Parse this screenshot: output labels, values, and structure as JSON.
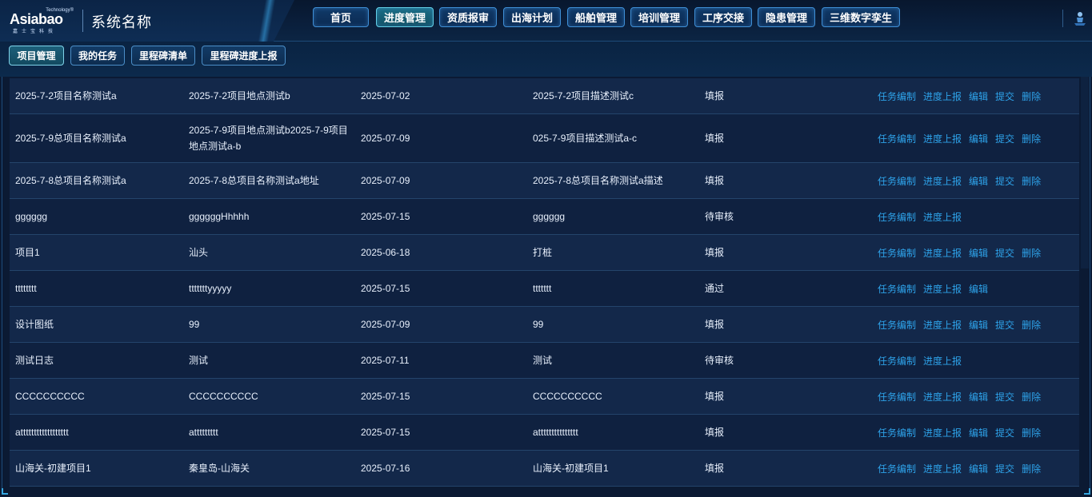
{
  "brand": {
    "logo_text": "Asiabao",
    "logo_tagline": "Technology®",
    "logo_sub": "嘉士宝科技",
    "system_name": "系统名称"
  },
  "main_nav": [
    {
      "label": "首页",
      "active": false
    },
    {
      "label": "进度管理",
      "active": true
    },
    {
      "label": "资质报审",
      "active": false
    },
    {
      "label": "出海计划",
      "active": false
    },
    {
      "label": "船舶管理",
      "active": false
    },
    {
      "label": "培训管理",
      "active": false
    },
    {
      "label": "工序交接",
      "active": false
    },
    {
      "label": "隐患管理",
      "active": false
    },
    {
      "label": "三维数字孪生",
      "active": false
    }
  ],
  "sub_nav": [
    {
      "label": "项目管理",
      "active": true
    },
    {
      "label": "我的任务",
      "active": false
    },
    {
      "label": "里程碑清单",
      "active": false
    },
    {
      "label": "里程碑进度上报",
      "active": false
    }
  ],
  "table": {
    "rows": [
      {
        "name": "2025-7-2项目名称测试a",
        "location": "2025-7-2项目地点测试b",
        "date": "2025-07-02",
        "description": "2025-7-2项目描述测试c",
        "status": "填报",
        "actions": [
          "任务编制",
          "进度上报",
          "编辑",
          "提交",
          "删除"
        ]
      },
      {
        "name": "2025-7-9总项目名称测试a",
        "location": "2025-7-9项目地点测试b2025-7-9项目地点测试a-b",
        "date": "2025-07-09",
        "description": "025-7-9项目描述测试a-c",
        "status": "填报",
        "actions": [
          "任务编制",
          "进度上报",
          "编辑",
          "提交",
          "删除"
        ]
      },
      {
        "name": "2025-7-8总项目名称测试a",
        "location": "2025-7-8总项目名称测试a地址",
        "date": "2025-07-09",
        "description": "2025-7-8总项目名称测试a描述",
        "status": "填报",
        "actions": [
          "任务编制",
          "进度上报",
          "编辑",
          "提交",
          "删除"
        ]
      },
      {
        "name": "gggggg",
        "location": "ggggggHhhhh",
        "date": "2025-07-15",
        "description": "gggggg",
        "status": "待审核",
        "actions": [
          "任务编制",
          "进度上报"
        ]
      },
      {
        "name": "项目1",
        "location": "汕头",
        "date": "2025-06-18",
        "description": "打桩",
        "status": "填报",
        "actions": [
          "任务编制",
          "进度上报",
          "编辑",
          "提交",
          "删除"
        ]
      },
      {
        "name": "tttttttt",
        "location": "tttttttyyyyy",
        "date": "2025-07-15",
        "description": "ttttttt",
        "status": "通过",
        "actions": [
          "任务编制",
          "进度上报",
          "编辑"
        ]
      },
      {
        "name": "设计图纸",
        "location": "99",
        "date": "2025-07-09",
        "description": "99",
        "status": "填报",
        "actions": [
          "任务编制",
          "进度上报",
          "编辑",
          "提交",
          "删除"
        ]
      },
      {
        "name": "测试日志",
        "location": "测试",
        "date": "2025-07-11",
        "description": "测试",
        "status": "待审核",
        "actions": [
          "任务编制",
          "进度上报"
        ]
      },
      {
        "name": "CCCCCCCCCC",
        "location": "CCCCCCCCCC",
        "date": "2025-07-15",
        "description": "CCCCCCCCCC",
        "status": "填报",
        "actions": [
          "任务编制",
          "进度上报",
          "编辑",
          "提交",
          "删除"
        ]
      },
      {
        "name": "atttttttttttttttttt",
        "location": "attttttttt",
        "date": "2025-07-15",
        "description": "attttttttttttttt",
        "status": "填报",
        "actions": [
          "任务编制",
          "进度上报",
          "编辑",
          "提交",
          "删除"
        ]
      },
      {
        "name": "山海关-初建项目1",
        "location": "秦皇岛-山海关",
        "date": "2025-07-16",
        "description": "山海关-初建项目1",
        "status": "填报",
        "actions": [
          "任务编制",
          "进度上报",
          "编辑",
          "提交",
          "删除"
        ]
      }
    ]
  },
  "icons": {
    "corner": "user-figure-icon"
  },
  "colors": {
    "accent": "#2ea3ea",
    "header_bg": "#0a1f3c",
    "row_even": "#13284a",
    "row_odd": "#0f2140"
  }
}
